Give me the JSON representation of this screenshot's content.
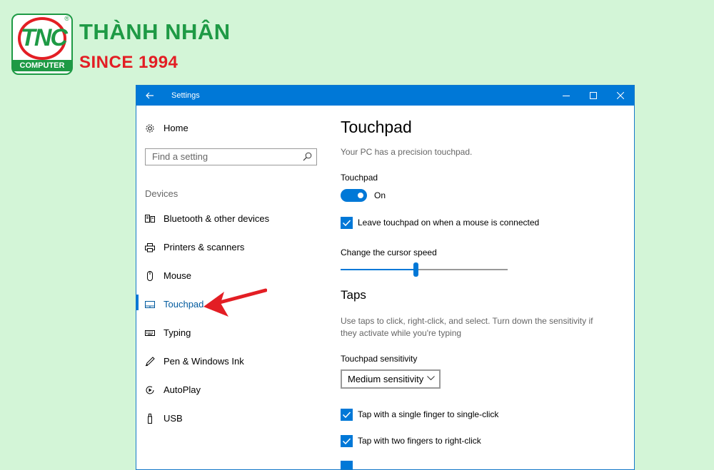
{
  "brand": {
    "logo_text": "TNC",
    "logo_sub": "COMPUTER",
    "name": "THÀNH NHÂN",
    "since": "SINCE 1994",
    "green": "#1e9a45",
    "red": "#e31e24"
  },
  "window": {
    "title": "Settings",
    "back_icon": "arrow-left-icon",
    "controls": [
      "minimize-icon",
      "maximize-icon",
      "close-icon"
    ]
  },
  "sidebar": {
    "home_label": "Home",
    "search_placeholder": "Find a setting",
    "section_label": "Devices",
    "items": [
      {
        "label": "Bluetooth & other devices",
        "icon": "bluetooth-devices-icon"
      },
      {
        "label": "Printers & scanners",
        "icon": "printer-icon"
      },
      {
        "label": "Mouse",
        "icon": "mouse-icon"
      },
      {
        "label": "Touchpad",
        "icon": "touchpad-icon",
        "selected": true
      },
      {
        "label": "Typing",
        "icon": "keyboard-icon"
      },
      {
        "label": "Pen & Windows Ink",
        "icon": "pen-icon"
      },
      {
        "label": "AutoPlay",
        "icon": "autoplay-icon"
      },
      {
        "label": "USB",
        "icon": "usb-icon"
      }
    ]
  },
  "main": {
    "title": "Touchpad",
    "subtitle": "Your PC has a precision touchpad.",
    "touchpad_label": "Touchpad",
    "toggle_state": "On",
    "toggle_on": true,
    "leave_on_label": "Leave touchpad on when a mouse is connected",
    "leave_on_checked": true,
    "cursor_speed_label": "Change the cursor speed",
    "cursor_speed_fraction": 0.45,
    "taps_heading": "Taps",
    "taps_desc_line1": "Use taps to click, right-click, and select. Turn down the sensitivity if",
    "taps_desc_line2": "they activate while you're typing",
    "sensitivity_label": "Touchpad sensitivity",
    "sensitivity_value": "Medium sensitivity",
    "single_tap_label": "Tap with a single finger to single-click",
    "single_tap_checked": true,
    "two_finger_label": "Tap with two fingers to right-click",
    "two_finger_checked": true,
    "accent": "#0078d7"
  }
}
